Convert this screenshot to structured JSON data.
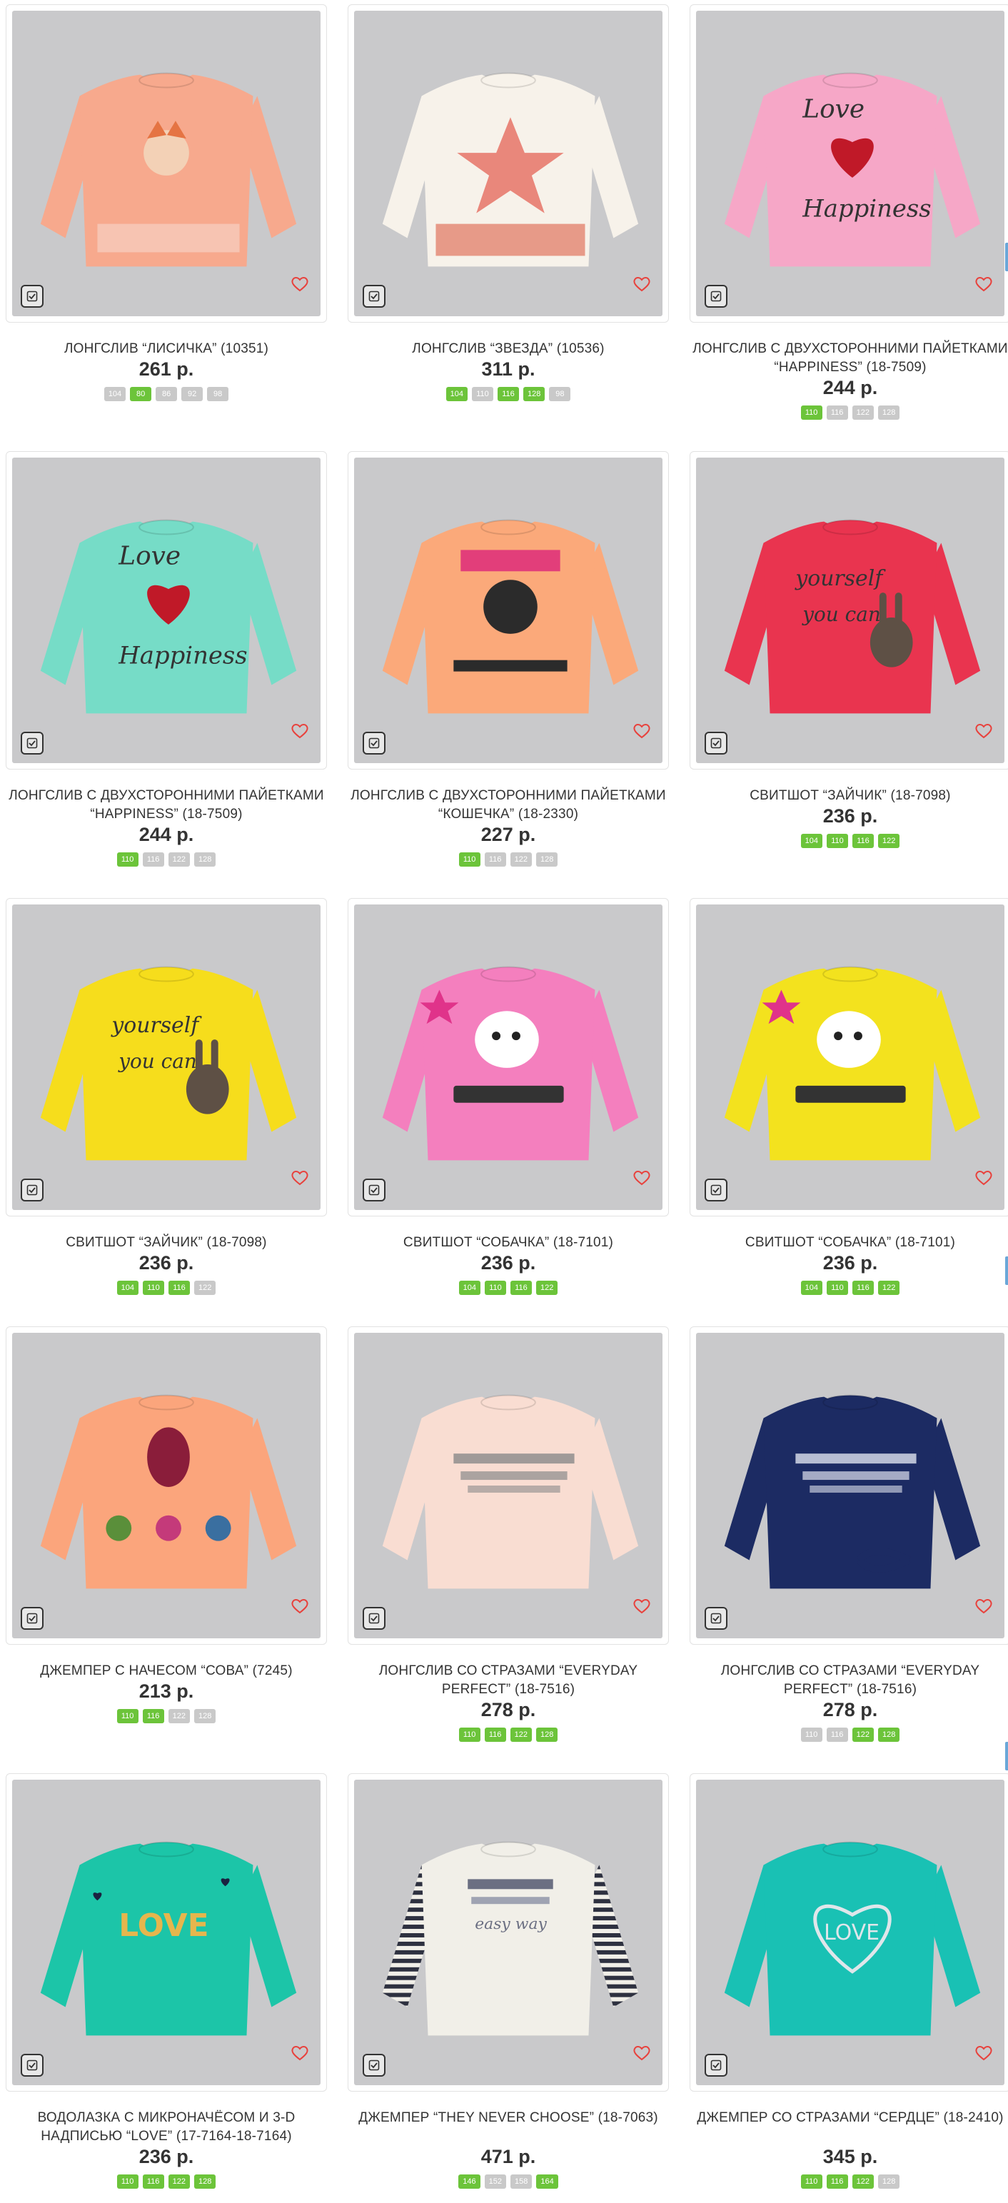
{
  "products": [
    {
      "title": "ЛОНГСЛИВ “ЛИСИЧКА” (10351)",
      "price": "261 р.",
      "sizes": [
        {
          "l": "104",
          "a": false
        },
        {
          "l": "80",
          "a": true
        },
        {
          "l": "86",
          "a": false
        },
        {
          "l": "92",
          "a": false
        },
        {
          "l": "98",
          "a": false
        }
      ],
      "shirt_color": "#f7a98d",
      "print": "fox"
    },
    {
      "title": "ЛОНГСЛИВ “ЗВЕЗДА” (10536)",
      "price": "311 р.",
      "sizes": [
        {
          "l": "104",
          "a": true
        },
        {
          "l": "110",
          "a": false
        },
        {
          "l": "116",
          "a": true
        },
        {
          "l": "128",
          "a": true
        },
        {
          "l": "98",
          "a": false
        }
      ],
      "shirt_color": "#f7f2ea",
      "print": "star"
    },
    {
      "title": "ЛОНГСЛИВ С ДВУХСТОРОННИМИ ПАЙЕТКАМИ “HAPPINESS” (18-7509)",
      "price": "244 р.",
      "sizes": [
        {
          "l": "110",
          "a": true
        },
        {
          "l": "116",
          "a": false
        },
        {
          "l": "122",
          "a": false
        },
        {
          "l": "128",
          "a": false
        }
      ],
      "shirt_color": "#f6a7c7",
      "print": "heart"
    },
    {
      "title": "ЛОНГСЛИВ С ДВУХСТОРОННИМИ ПАЙЕТКАМИ “HAPPINESS” (18-7509)",
      "price": "244 р.",
      "sizes": [
        {
          "l": "110",
          "a": true
        },
        {
          "l": "116",
          "a": false
        },
        {
          "l": "122",
          "a": false
        },
        {
          "l": "128",
          "a": false
        }
      ],
      "shirt_color": "#76dcc7",
      "print": "heart"
    },
    {
      "title": "ЛОНГСЛИВ С ДВУХСТОРОННИМИ ПАЙЕТКАМИ “КОШЕЧКА” (18-2330)",
      "price": "227 р.",
      "sizes": [
        {
          "l": "110",
          "a": true
        },
        {
          "l": "116",
          "a": false
        },
        {
          "l": "122",
          "a": false
        },
        {
          "l": "128",
          "a": false
        }
      ],
      "shirt_color": "#fba97a",
      "print": "cat"
    },
    {
      "title": "СВИТШОТ “ЗАЙЧИК” (18-7098)",
      "price": "236 р.",
      "sizes": [
        {
          "l": "104",
          "a": true
        },
        {
          "l": "110",
          "a": true
        },
        {
          "l": "116",
          "a": true
        },
        {
          "l": "122",
          "a": true
        }
      ],
      "shirt_color": "#e9344f",
      "print": "bunny"
    },
    {
      "title": "СВИТШОТ “ЗАЙЧИК” (18-7098)",
      "price": "236 р.",
      "sizes": [
        {
          "l": "104",
          "a": true
        },
        {
          "l": "110",
          "a": true
        },
        {
          "l": "116",
          "a": true
        },
        {
          "l": "122",
          "a": false
        }
      ],
      "shirt_color": "#f6dd1c",
      "print": "bunny"
    },
    {
      "title": "СВИТШОТ “СОБАЧКА” (18-7101)",
      "price": "236 р.",
      "sizes": [
        {
          "l": "104",
          "a": true
        },
        {
          "l": "110",
          "a": true
        },
        {
          "l": "116",
          "a": true
        },
        {
          "l": "122",
          "a": true
        }
      ],
      "shirt_color": "#f47fbe",
      "print": "dog"
    },
    {
      "title": "СВИТШОТ “СОБАЧКА” (18-7101)",
      "price": "236 р.",
      "sizes": [
        {
          "l": "104",
          "a": true
        },
        {
          "l": "110",
          "a": true
        },
        {
          "l": "116",
          "a": true
        },
        {
          "l": "122",
          "a": true
        }
      ],
      "shirt_color": "#f3e21e",
      "print": "dog"
    },
    {
      "title": "ДЖЕМПЕР С НАЧЕСОМ “СОВА” (7245)",
      "price": "213 р.",
      "sizes": [
        {
          "l": "110",
          "a": true
        },
        {
          "l": "116",
          "a": true
        },
        {
          "l": "122",
          "a": false
        },
        {
          "l": "128",
          "a": false
        }
      ],
      "shirt_color": "#fba57c",
      "print": "owl"
    },
    {
      "title": "ЛОНГСЛИВ СО СТРАЗАМИ “EVERYDAY PERFECT” (18-7516)",
      "price": "278 р.",
      "sizes": [
        {
          "l": "110",
          "a": true
        },
        {
          "l": "116",
          "a": true
        },
        {
          "l": "122",
          "a": true
        },
        {
          "l": "128",
          "a": true
        }
      ],
      "shirt_color": "#f9ddd2",
      "print": "text"
    },
    {
      "title": "ЛОНГСЛИВ СО СТРАЗАМИ “EVERYDAY PERFECT” (18-7516)",
      "price": "278 р.",
      "sizes": [
        {
          "l": "110",
          "a": false
        },
        {
          "l": "116",
          "a": false
        },
        {
          "l": "122",
          "a": true
        },
        {
          "l": "128",
          "a": true
        }
      ],
      "shirt_color": "#1c2b63",
      "print": "text"
    },
    {
      "title": "ВОДОЛАЗКА С МИКРОНАЧЁСОМ И 3-D НАДПИСЬЮ “LOVE” (17-7164-18-7164)",
      "price": "236 р.",
      "sizes": [
        {
          "l": "110",
          "a": true
        },
        {
          "l": "116",
          "a": true
        },
        {
          "l": "122",
          "a": true
        },
        {
          "l": "128",
          "a": true
        }
      ],
      "shirt_color": "#1cc5a8",
      "print": "love"
    },
    {
      "title": "ДЖЕМПЕР “THEY NEVER CHOOSE” (18-7063)",
      "price": "471 р.",
      "sizes": [
        {
          "l": "146",
          "a": true
        },
        {
          "l": "152",
          "a": false
        },
        {
          "l": "158",
          "a": false
        },
        {
          "l": "164",
          "a": true
        }
      ],
      "shirt_color": "#f1efe8",
      "print": "striped"
    },
    {
      "title": "ДЖЕМПЕР СО СТРАЗАМИ “СЕРДЦЕ” (18-2410)",
      "price": "345 р.",
      "sizes": [
        {
          "l": "110",
          "a": true
        },
        {
          "l": "116",
          "a": true
        },
        {
          "l": "122",
          "a": true
        },
        {
          "l": "128",
          "a": false
        }
      ],
      "shirt_color": "#19c1b4",
      "print": "loveheart"
    }
  ],
  "icons": {
    "compare": "compare-checkbox-icon",
    "favorite": "heart-outline-icon"
  },
  "colors": {
    "size_available": "#6cc43a",
    "size_unavailable": "#c9c9c9",
    "favorite": "#e8413c",
    "photo_background": "#c9c9cb"
  }
}
